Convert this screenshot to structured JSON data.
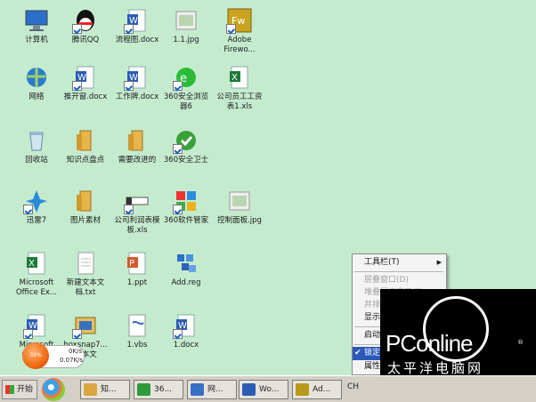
{
  "desktop": {
    "icons": [
      {
        "label": "计算机",
        "kind": "computer"
      },
      {
        "label": "腾讯QQ",
        "kind": "qq"
      },
      {
        "label": "流程图.docx",
        "kind": "word"
      },
      {
        "label": "1.1.jpg",
        "kind": "image"
      },
      {
        "label": "Adobe\nFirewo...",
        "kind": "fireworks"
      },
      {
        "label": "网络",
        "kind": "network"
      },
      {
        "label": "推开窗.docx",
        "kind": "word"
      },
      {
        "label": "工作牌.docx",
        "kind": "word"
      },
      {
        "label": "360安全浏览\n器6",
        "kind": "ie360"
      },
      {
        "label": "公司员工工资\n表1.xls",
        "kind": "excel"
      },
      {
        "label": "回收站",
        "kind": "recycle"
      },
      {
        "label": "知识点盘点",
        "kind": "folder"
      },
      {
        "label": "需要改进的",
        "kind": "folder"
      },
      {
        "label": "360安全卫士",
        "kind": "guard360"
      },
      {
        "label": "迅雷7",
        "kind": "thunder"
      },
      {
        "label": "图片素材",
        "kind": "folder"
      },
      {
        "label": "公司利润表模\n板.xls",
        "kind": "xlsblank"
      },
      {
        "label": "360软件管家",
        "kind": "soft360"
      },
      {
        "label": "控制面板.jpg",
        "kind": "image"
      },
      {
        "label": "Microsoft\nOffice Ex...",
        "kind": "excel"
      },
      {
        "label": "新建文本文\n档.txt",
        "kind": "txt"
      },
      {
        "label": "1.ppt",
        "kind": "ppt"
      },
      {
        "label": "Add.reg",
        "kind": "reg"
      },
      {
        "label": "Microsoft\nOffice...",
        "kind": "word"
      },
      {
        "label": "hoxsnap7...\n文本文",
        "kind": "snap"
      },
      {
        "label": "1.vbs",
        "kind": "vbs"
      },
      {
        "label": "1.docx",
        "kind": "word"
      }
    ]
  },
  "context_menu": {
    "items": [
      {
        "label": "工具栏(T)",
        "state": "normal",
        "submenu": true
      },
      {
        "label": "层叠窗口(D)",
        "state": "disabled"
      },
      {
        "label": "堆叠显示窗口(T)",
        "state": "disabled"
      },
      {
        "label": "并排显示窗口(I)",
        "state": "disabled"
      },
      {
        "label": "显示桌面(S)",
        "state": "normal"
      },
      {
        "label": "启动任务管理器(K)",
        "state": "normal"
      },
      {
        "label": "锁定任务栏(L)",
        "state": "selected",
        "checked": true
      },
      {
        "label": "属性(R)",
        "state": "normal"
      }
    ]
  },
  "speed_widget": {
    "badge": "33%",
    "up": "0K/s",
    "down": "0.07K/s"
  },
  "taskbar": {
    "start_label": "开始",
    "buttons": [
      {
        "label": "知...",
        "color": "#d9a640"
      },
      {
        "label": "36...",
        "color": "#2e9a3a"
      },
      {
        "label": "网...",
        "color": "#3a6fc6"
      },
      {
        "label": "Wo...",
        "color": "#2b5bb5"
      },
      {
        "label": "Ad...",
        "color": "#b89a1c"
      }
    ],
    "lang": "CH"
  },
  "watermark": {
    "brand": "PConline",
    "cn": "太平洋电脑网",
    "reg": "®"
  }
}
